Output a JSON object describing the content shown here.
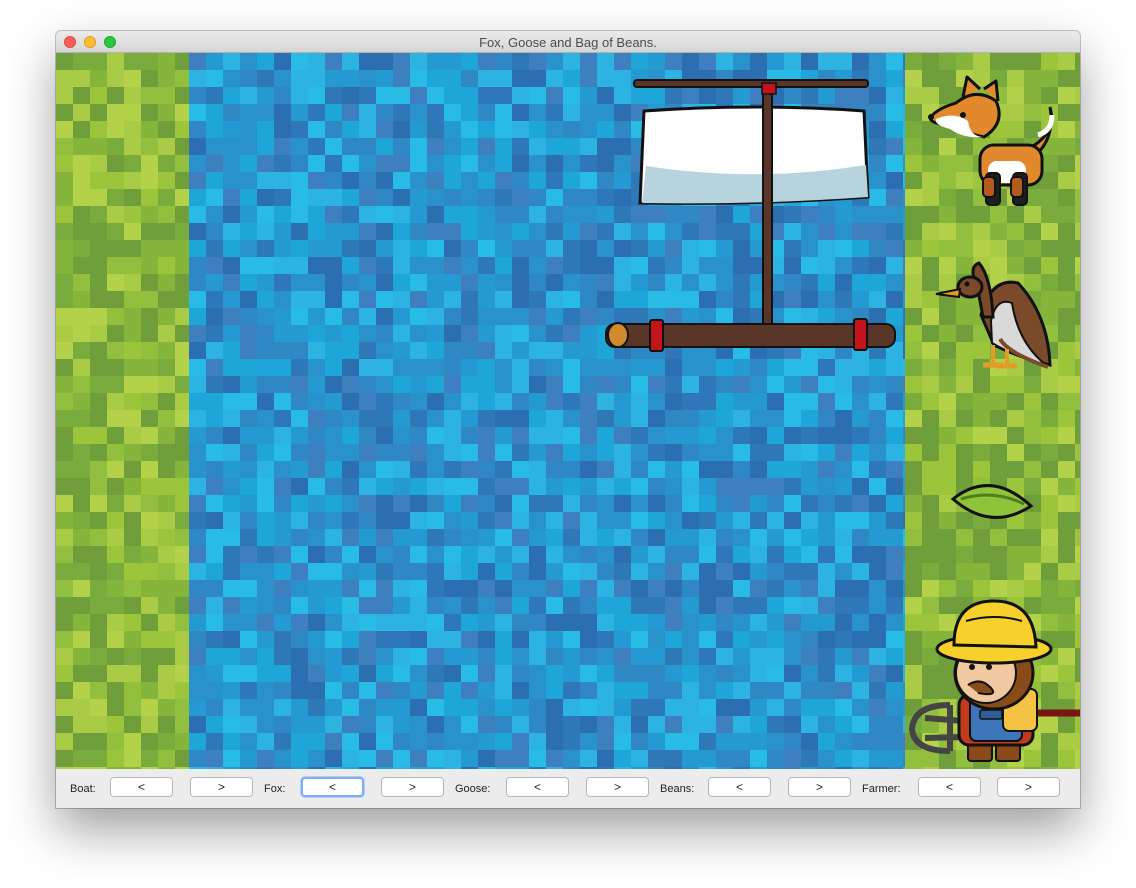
{
  "window": {
    "title": "Fox, Goose and Bag of Beans."
  },
  "scene": {
    "left_bank": "grass",
    "river": "water",
    "right_bank": "grass",
    "boat": {
      "icon": "raft-icon"
    },
    "characters": [
      {
        "name": "fox",
        "icon": "fox-icon"
      },
      {
        "name": "goose",
        "icon": "goose-icon"
      },
      {
        "name": "beans",
        "icon": "bean-icon"
      },
      {
        "name": "farmer",
        "icon": "farmer-icon"
      }
    ]
  },
  "controls": {
    "left_arrow": "<",
    "right_arrow": ">",
    "groups": [
      {
        "id": "boat",
        "label": "Boat:"
      },
      {
        "id": "fox",
        "label": "Fox:",
        "focused": "left"
      },
      {
        "id": "goose",
        "label": "Goose:"
      },
      {
        "id": "beans",
        "label": "Beans:"
      },
      {
        "id": "farmer",
        "label": "Farmer:"
      }
    ]
  },
  "colors": {
    "grass_light": "#9cc53c",
    "grass_dark": "#6f9e3a",
    "water_light": "#2cb3e2",
    "water_dark": "#2c6fb0",
    "focus_ring": "#7eaaf6"
  }
}
